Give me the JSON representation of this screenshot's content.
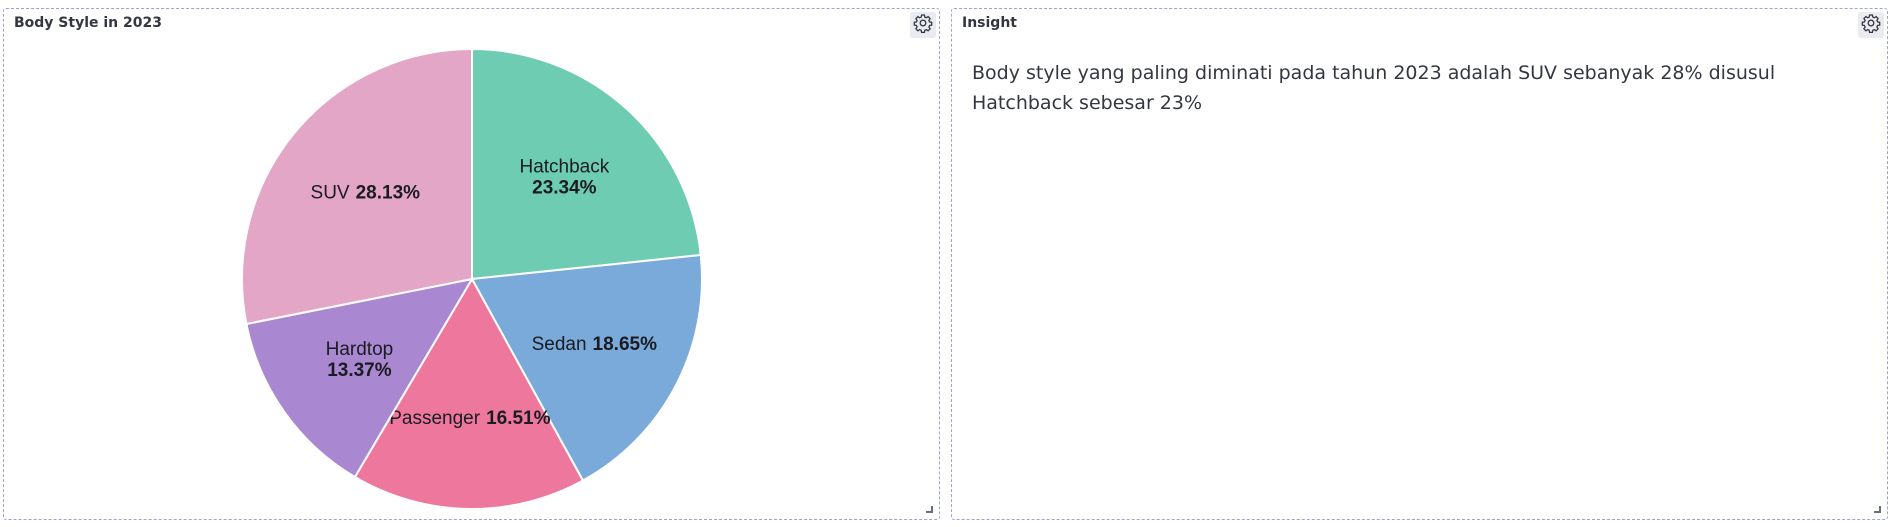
{
  "left_panel": {
    "title": "Body Style in 2023"
  },
  "right_panel": {
    "title": "Insight",
    "text": "Body style yang paling diminati pada tahun 2023 adalah SUV sebanyak 28% disusul Hatchback sebesar 23%"
  },
  "icons": {
    "settings": "gear-icon",
    "resize": "resize-handle-icon"
  },
  "chart_data": {
    "type": "pie",
    "title": "Body Style in 2023",
    "slices": [
      {
        "label": "Hatchback",
        "value": 23.34,
        "display": "23.34%",
        "color": "#6dccb1"
      },
      {
        "label": "Sedan",
        "value": 18.65,
        "display": "18.65%",
        "color": "#79aad9"
      },
      {
        "label": "Passenger",
        "value": 16.51,
        "display": "16.51%",
        "color": "#ee789d"
      },
      {
        "label": "Hardtop",
        "value": 13.37,
        "display": "13.37%",
        "color": "#a987d1"
      },
      {
        "label": "SUV",
        "value": 28.13,
        "display": "28.13%",
        "color": "#e4a6c7"
      }
    ]
  }
}
